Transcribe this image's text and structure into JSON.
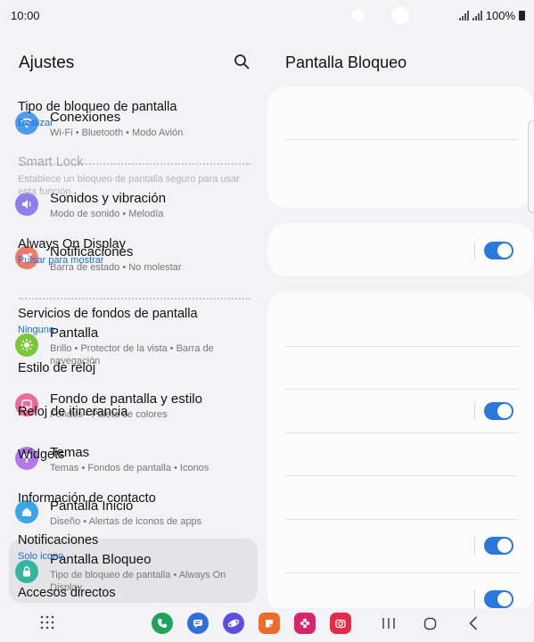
{
  "status": {
    "time": "10:00",
    "battery": "100%"
  },
  "left": {
    "title": "Ajustes",
    "items": [
      {
        "title": "Conexiones",
        "sub": "Wi-Fi  •  Bluetooth  •  Modo Avión",
        "color": "#4e9cf0"
      },
      {
        "title": "Sonidos y vibración",
        "sub": "Modo de sonido  •  Melodía",
        "color": "#8f7ef0"
      },
      {
        "title": "Notificaciones",
        "sub": "Barra de estado  •  No molestar",
        "color": "#f07a6a"
      },
      {
        "title": "Pantalla",
        "sub": "Brillo  •  Protector de la vista  •  Barra de navegación",
        "color": "#7cc63c"
      },
      {
        "title": "Fondo de pantalla y estilo",
        "sub": "Fondos  •  Paleta de colores",
        "color": "#ea6d96"
      },
      {
        "title": "Temas",
        "sub": "Temas  •  Fondos de pantalla  •  Iconos",
        "color": "#b27ae8"
      },
      {
        "title": "Pantalla Inicio",
        "sub": "Diseño  •  Alertas de iconos de apps",
        "color": "#3aa8e8"
      },
      {
        "title": "Pantalla Bloqueo",
        "sub": "Tipo de bloqueo de pantalla  •  Always On Display",
        "color": "#35b5a0"
      }
    ]
  },
  "right": {
    "title": "Pantalla Bloqueo",
    "rows": {
      "lock_type": {
        "title": "Tipo de bloqueo de pantalla",
        "sub": "Deslizar"
      },
      "smart_lock": {
        "title": "Smart Lock",
        "sub": "Establece un bloqueo de pantalla seguro para usar esta función."
      },
      "aod": {
        "title": "Always On Display",
        "sub": "Pulsar para mostrar"
      },
      "wallpaper_services": {
        "title": "Servicios de fondos de pantalla",
        "sub": "Ninguno"
      },
      "clock_style": {
        "title": "Estilo de reloj"
      },
      "roaming_clock": {
        "title": "Reloj de itinerancia"
      },
      "widgets": {
        "title": "Widgets"
      },
      "contact_info": {
        "title": "Información de contacto"
      },
      "notifications": {
        "title": "Notificaciones",
        "sub": "Solo icono"
      },
      "shortcuts": {
        "title": "Accesos directos"
      }
    }
  },
  "accent": "#2a78dc"
}
